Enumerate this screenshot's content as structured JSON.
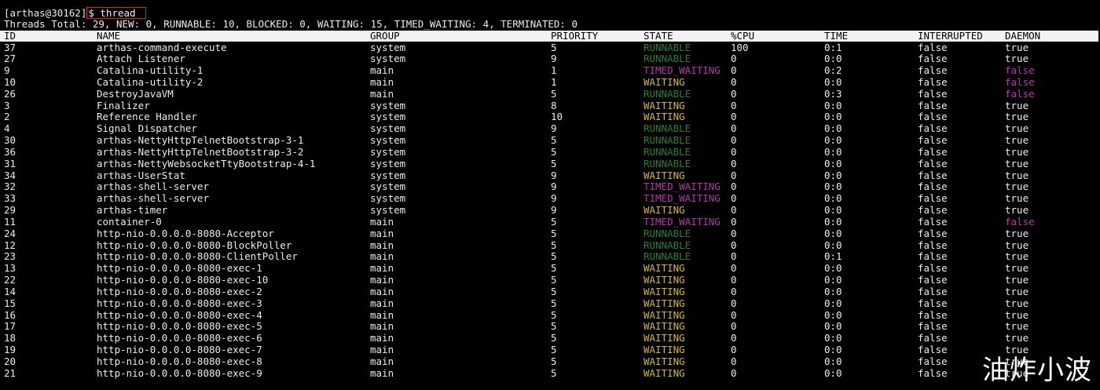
{
  "terminal": {
    "prompt": "[arthas@30162]",
    "command": "$ thread",
    "summary": "Threads Total: 29, NEW: 0, RUNNABLE: 10, BLOCKED: 0, WAITING: 15, TIMED_WAITING: 4, TERMINATED: 0"
  },
  "headers": {
    "id": "ID",
    "name": "NAME",
    "group": "GROUP",
    "priority": "PRIORITY",
    "state": "STATE",
    "cpu": "%CPU",
    "time": "TIME",
    "interrupted": "INTERRUPTED",
    "daemon": "DAEMON"
  },
  "colors": {
    "background": "#000000",
    "text": "#ececec",
    "header_bg": "#f2f2f2",
    "header_text": "#000000",
    "runnable": "#2e7d32",
    "waiting": "#d6b53c",
    "timed_waiting": "#b23aa8",
    "daemon_false": "#b23aa8",
    "highlight_box": "#e0242a"
  },
  "threads": [
    {
      "id": "37",
      "name": "arthas-command-execute",
      "group": "system",
      "priority": "5",
      "state": "RUNNABLE",
      "cpu": "100",
      "time": "0:1",
      "interrupted": "false",
      "daemon": "true"
    },
    {
      "id": "27",
      "name": "Attach Listener",
      "group": "system",
      "priority": "9",
      "state": "RUNNABLE",
      "cpu": "0",
      "time": "0:0",
      "interrupted": "false",
      "daemon": "true"
    },
    {
      "id": "9",
      "name": "Catalina-utility-1",
      "group": "main",
      "priority": "1",
      "state": "TIMED_WAITING",
      "cpu": "0",
      "time": "0:2",
      "interrupted": "false",
      "daemon": "false"
    },
    {
      "id": "10",
      "name": "Catalina-utility-2",
      "group": "main",
      "priority": "1",
      "state": "WAITING",
      "cpu": "0",
      "time": "0:0",
      "interrupted": "false",
      "daemon": "false"
    },
    {
      "id": "26",
      "name": "DestroyJavaVM",
      "group": "main",
      "priority": "5",
      "state": "RUNNABLE",
      "cpu": "0",
      "time": "0:3",
      "interrupted": "false",
      "daemon": "false"
    },
    {
      "id": "3",
      "name": "Finalizer",
      "group": "system",
      "priority": "8",
      "state": "WAITING",
      "cpu": "0",
      "time": "0:0",
      "interrupted": "false",
      "daemon": "true"
    },
    {
      "id": "2",
      "name": "Reference Handler",
      "group": "system",
      "priority": "10",
      "state": "WAITING",
      "cpu": "0",
      "time": "0:0",
      "interrupted": "false",
      "daemon": "true"
    },
    {
      "id": "4",
      "name": "Signal Dispatcher",
      "group": "system",
      "priority": "9",
      "state": "RUNNABLE",
      "cpu": "0",
      "time": "0:0",
      "interrupted": "false",
      "daemon": "true"
    },
    {
      "id": "30",
      "name": "arthas-NettyHttpTelnetBootstrap-3-1",
      "group": "system",
      "priority": "5",
      "state": "RUNNABLE",
      "cpu": "0",
      "time": "0:0",
      "interrupted": "false",
      "daemon": "true"
    },
    {
      "id": "36",
      "name": "arthas-NettyHttpTelnetBootstrap-3-2",
      "group": "system",
      "priority": "5",
      "state": "RUNNABLE",
      "cpu": "0",
      "time": "0:0",
      "interrupted": "false",
      "daemon": "true"
    },
    {
      "id": "31",
      "name": "arthas-NettyWebsocketTtyBootstrap-4-1",
      "group": "system",
      "priority": "5",
      "state": "RUNNABLE",
      "cpu": "0",
      "time": "0:0",
      "interrupted": "false",
      "daemon": "true"
    },
    {
      "id": "34",
      "name": "arthas-UserStat",
      "group": "system",
      "priority": "9",
      "state": "WAITING",
      "cpu": "0",
      "time": "0:0",
      "interrupted": "false",
      "daemon": "true"
    },
    {
      "id": "32",
      "name": "arthas-shell-server",
      "group": "system",
      "priority": "9",
      "state": "TIMED_WAITING",
      "cpu": "0",
      "time": "0:0",
      "interrupted": "false",
      "daemon": "true"
    },
    {
      "id": "33",
      "name": "arthas-shell-server",
      "group": "system",
      "priority": "9",
      "state": "TIMED_WAITING",
      "cpu": "0",
      "time": "0:0",
      "interrupted": "false",
      "daemon": "true"
    },
    {
      "id": "29",
      "name": "arthas-timer",
      "group": "system",
      "priority": "9",
      "state": "WAITING",
      "cpu": "0",
      "time": "0:0",
      "interrupted": "false",
      "daemon": "true"
    },
    {
      "id": "11",
      "name": "container-0",
      "group": "main",
      "priority": "5",
      "state": "TIMED_WAITING",
      "cpu": "0",
      "time": "0:0",
      "interrupted": "false",
      "daemon": "false"
    },
    {
      "id": "24",
      "name": "http-nio-0.0.0.0-8080-Acceptor",
      "group": "main",
      "priority": "5",
      "state": "RUNNABLE",
      "cpu": "0",
      "time": "0:0",
      "interrupted": "false",
      "daemon": "true"
    },
    {
      "id": "12",
      "name": "http-nio-0.0.0.0-8080-BlockPoller",
      "group": "main",
      "priority": "5",
      "state": "RUNNABLE",
      "cpu": "0",
      "time": "0:0",
      "interrupted": "false",
      "daemon": "true"
    },
    {
      "id": "23",
      "name": "http-nio-0.0.0.0-8080-ClientPoller",
      "group": "main",
      "priority": "5",
      "state": "RUNNABLE",
      "cpu": "0",
      "time": "0:1",
      "interrupted": "false",
      "daemon": "true"
    },
    {
      "id": "13",
      "name": "http-nio-0.0.0.0-8080-exec-1",
      "group": "main",
      "priority": "5",
      "state": "WAITING",
      "cpu": "0",
      "time": "0:0",
      "interrupted": "false",
      "daemon": "true"
    },
    {
      "id": "22",
      "name": "http-nio-0.0.0.0-8080-exec-10",
      "group": "main",
      "priority": "5",
      "state": "WAITING",
      "cpu": "0",
      "time": "0:0",
      "interrupted": "false",
      "daemon": "true"
    },
    {
      "id": "14",
      "name": "http-nio-0.0.0.0-8080-exec-2",
      "group": "main",
      "priority": "5",
      "state": "WAITING",
      "cpu": "0",
      "time": "0:0",
      "interrupted": "false",
      "daemon": "true"
    },
    {
      "id": "15",
      "name": "http-nio-0.0.0.0-8080-exec-3",
      "group": "main",
      "priority": "5",
      "state": "WAITING",
      "cpu": "0",
      "time": "0:0",
      "interrupted": "false",
      "daemon": "true"
    },
    {
      "id": "16",
      "name": "http-nio-0.0.0.0-8080-exec-4",
      "group": "main",
      "priority": "5",
      "state": "WAITING",
      "cpu": "0",
      "time": "0:0",
      "interrupted": "false",
      "daemon": "true"
    },
    {
      "id": "17",
      "name": "http-nio-0.0.0.0-8080-exec-5",
      "group": "main",
      "priority": "5",
      "state": "WAITING",
      "cpu": "0",
      "time": "0:0",
      "interrupted": "false",
      "daemon": "true"
    },
    {
      "id": "18",
      "name": "http-nio-0.0.0.0-8080-exec-6",
      "group": "main",
      "priority": "5",
      "state": "WAITING",
      "cpu": "0",
      "time": "0:0",
      "interrupted": "false",
      "daemon": "true"
    },
    {
      "id": "19",
      "name": "http-nio-0.0.0.0-8080-exec-7",
      "group": "main",
      "priority": "5",
      "state": "WAITING",
      "cpu": "0",
      "time": "0:0",
      "interrupted": "false",
      "daemon": "true"
    },
    {
      "id": "20",
      "name": "http-nio-0.0.0.0-8080-exec-8",
      "group": "main",
      "priority": "5",
      "state": "WAITING",
      "cpu": "0",
      "time": "0:0",
      "interrupted": "false",
      "daemon": "true"
    },
    {
      "id": "21",
      "name": "http-nio-0.0.0.0-8080-exec-9",
      "group": "main",
      "priority": "5",
      "state": "WAITING",
      "cpu": "0",
      "time": "0:0",
      "interrupted": "false",
      "daemon": "true"
    }
  ],
  "watermark": "油炸小波"
}
